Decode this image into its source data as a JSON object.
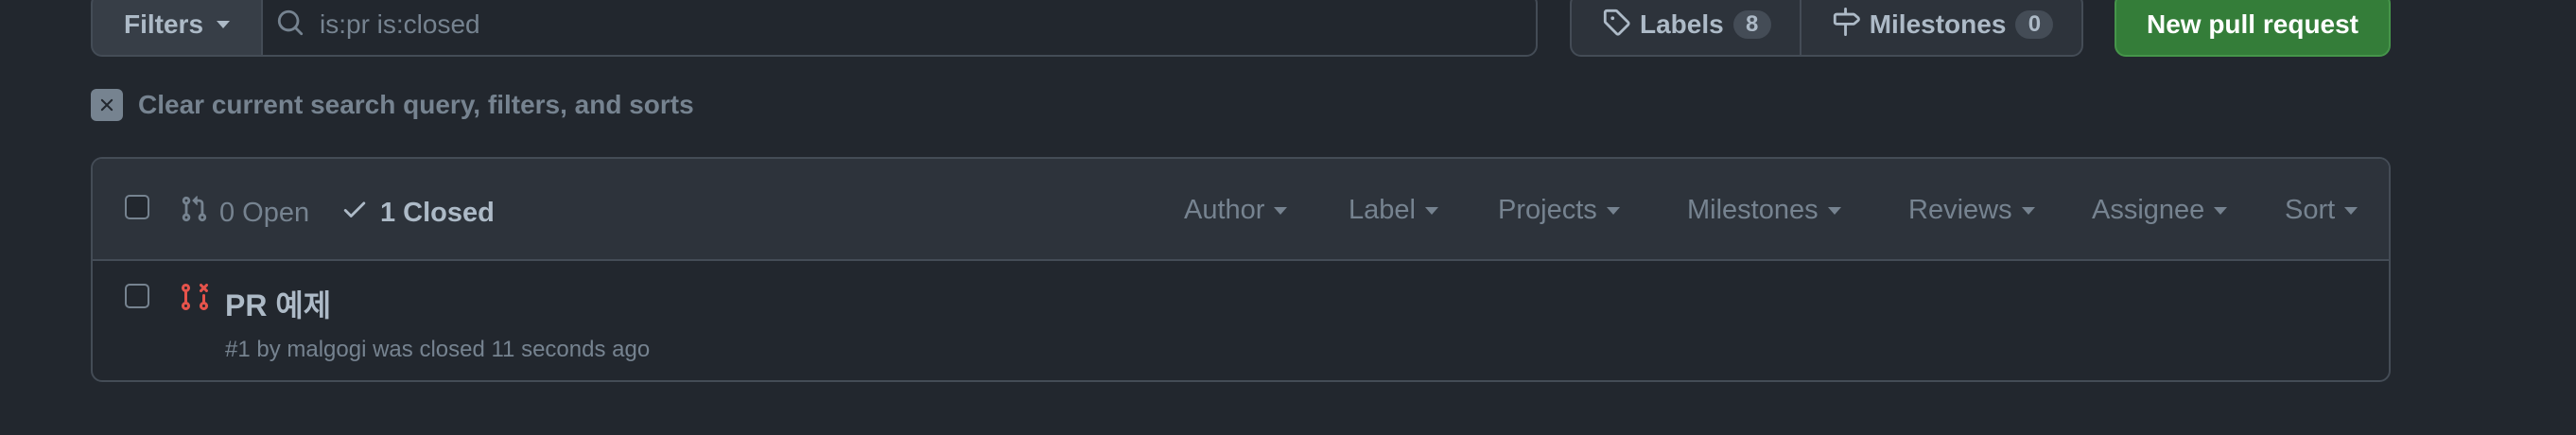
{
  "toolbar": {
    "filters_label": "Filters",
    "search_value": "is:pr is:closed",
    "labels_label": "Labels",
    "labels_count": "8",
    "milestones_label": "Milestones",
    "milestones_count": "0",
    "new_pr_label": "New pull request"
  },
  "clear": {
    "text": "Clear current search query, filters, and sorts"
  },
  "list_header": {
    "open_label": "0 Open",
    "closed_label": "1 Closed",
    "filters": [
      "Author",
      "Label",
      "Projects",
      "Milestones",
      "Reviews",
      "Assignee",
      "Sort"
    ]
  },
  "pull_requests": [
    {
      "title": "PR 예제",
      "meta": "#1 by malgogi was closed 11 seconds ago"
    }
  ],
  "colors": {
    "background": "#22272e",
    "header_bg": "#2d333b",
    "border": "#444c56",
    "primary_button": "#347d39",
    "closed_pr_icon": "#e5534b",
    "muted_text": "#768390"
  }
}
